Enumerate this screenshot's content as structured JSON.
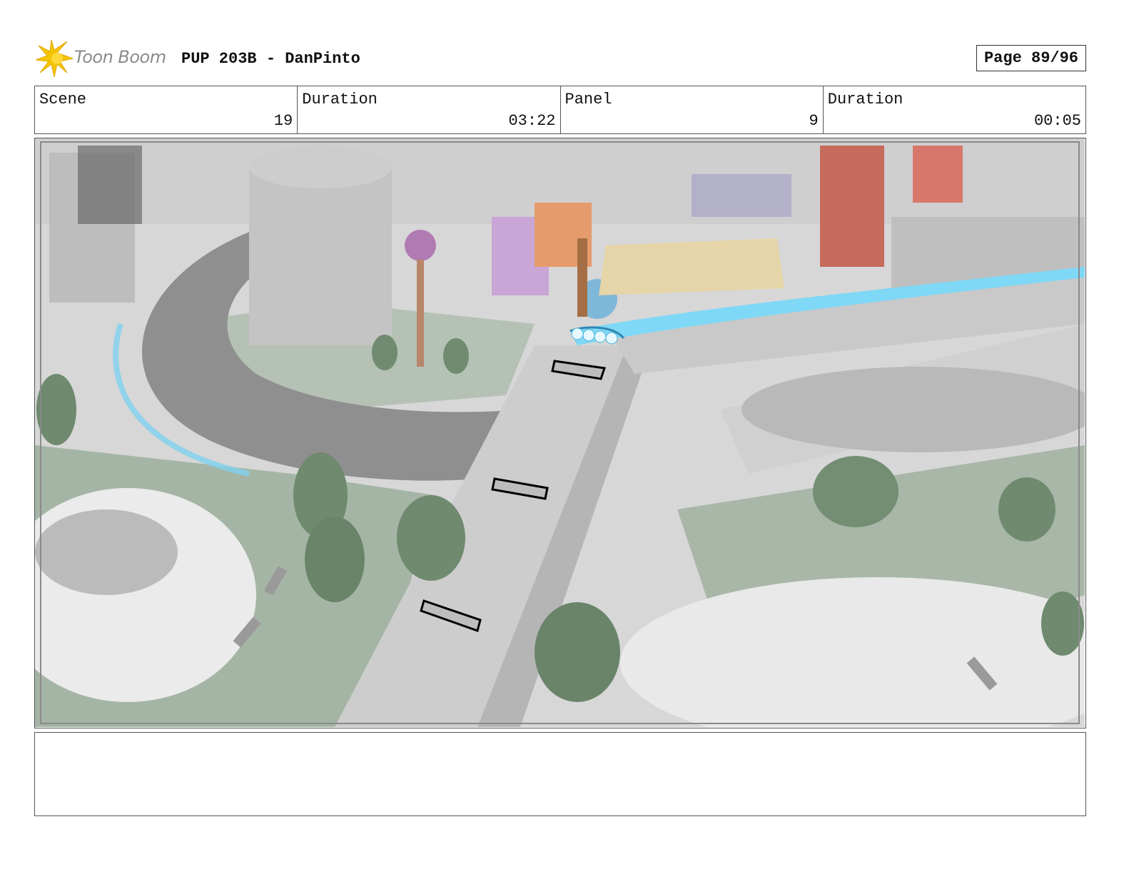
{
  "header": {
    "brand_name": "Toon Boom",
    "doc_title": "PUP 203B - DanPinto",
    "page_label": "Page 89/96"
  },
  "info": {
    "scene_label": "Scene",
    "scene_value": "19",
    "scene_duration_label": "Duration",
    "scene_duration_value": "03:22",
    "panel_label": "Panel",
    "panel_value": "9",
    "panel_duration_label": "Duration",
    "panel_duration_value": "00:05"
  },
  "colors": {
    "logo_yellow": "#f5c400",
    "water": "#7fd8f5",
    "grass": "#9aaf9a",
    "road": "#8e8e8e"
  },
  "notes": {
    "text": ""
  }
}
